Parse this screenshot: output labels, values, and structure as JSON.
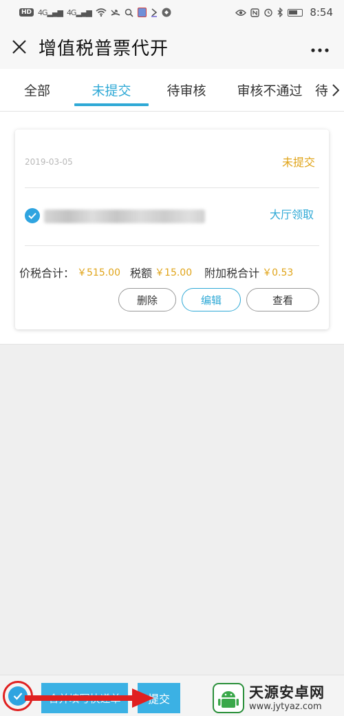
{
  "status_bar": {
    "badge": "HD",
    "sig1": "4G",
    "sig2": "4G",
    "time": "8:54"
  },
  "header": {
    "title": "增值税普票代开"
  },
  "tabs": [
    {
      "label": "全部"
    },
    {
      "label": "未提交"
    },
    {
      "label": "待审核"
    },
    {
      "label": "审核不通过"
    },
    {
      "label": "待"
    }
  ],
  "order": {
    "date": "2019-03-05",
    "status": "未提交",
    "pickup": "大厅领取",
    "total_label": "价税合计：",
    "total_value": "￥515.00",
    "tax_label": "税额",
    "tax_value": "￥15.00",
    "surtax_label": "附加税合计",
    "surtax_value": "￥0.53",
    "buttons": {
      "delete": "删除",
      "edit": "编辑",
      "view": "查看"
    }
  },
  "bottom_bar": {
    "merge_label": "合并填写快递单",
    "submit_label": "提交"
  },
  "watermark": {
    "name": "天源安卓网",
    "url": "www.jytyaz.com"
  },
  "colors": {
    "accent": "#2fa9d6",
    "status": "#e0a419",
    "button_bg": "#3bb1e4",
    "annotation": "#e02020"
  }
}
